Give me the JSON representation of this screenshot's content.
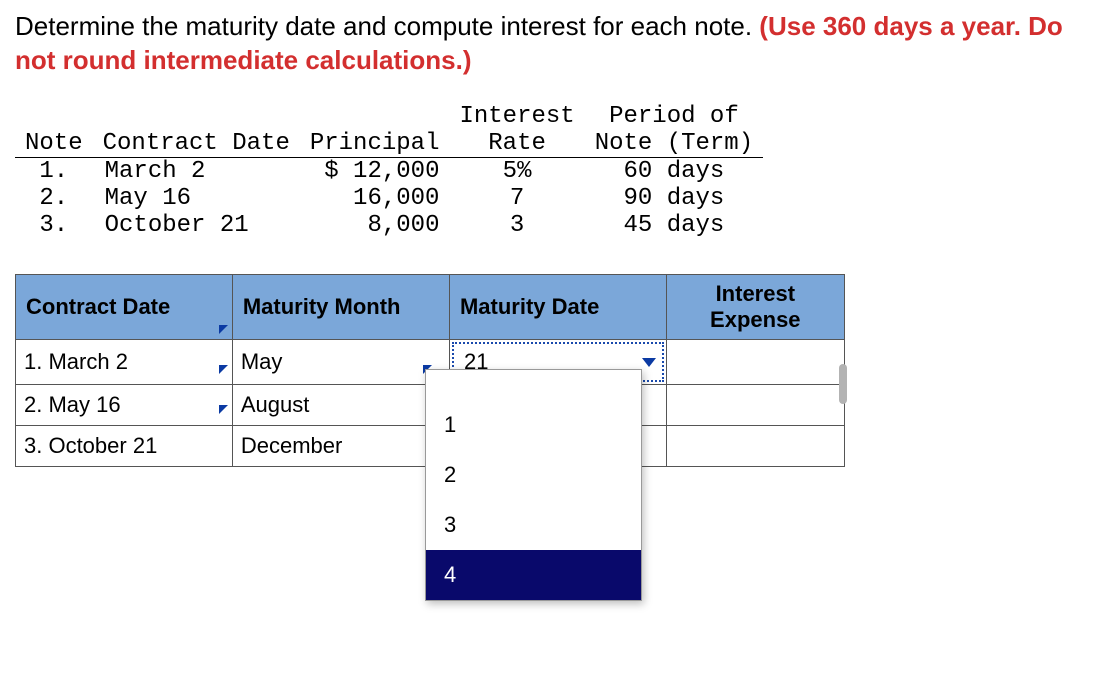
{
  "instruction": {
    "prefix": "Determine the maturity date and compute interest for each note. ",
    "emph": "(Use 360 days a year. Do not round intermediate calculations.)"
  },
  "data_table": {
    "headers": {
      "note": "Note",
      "contract_date": "Contract Date",
      "principal": "Principal",
      "interest_rate_l1": "Interest",
      "interest_rate_l2": "Rate",
      "period_l1": "Period of",
      "period_l2": "Note (Term)"
    },
    "rows": [
      {
        "note": "1.",
        "contract_date": "March 2",
        "principal": "$ 12,000",
        "rate": "5%",
        "term": "60 days"
      },
      {
        "note": "2.",
        "contract_date": "May 16",
        "principal": "16,000",
        "rate": "7",
        "term": "90 days"
      },
      {
        "note": "3.",
        "contract_date": "October 21",
        "principal": "8,000",
        "rate": "3",
        "term": "45 days"
      }
    ]
  },
  "answer_table": {
    "headers": {
      "contract_date": "Contract Date",
      "maturity_month": "Maturity Month",
      "maturity_date": "Maturity Date",
      "interest_expense_l1": "Interest",
      "interest_expense_l2": "Expense"
    },
    "rows": [
      {
        "contract_date": "1. March 2",
        "maturity_month": "May",
        "maturity_date": "21",
        "interest_expense": ""
      },
      {
        "contract_date": "2. May 16",
        "maturity_month": "August",
        "maturity_date": "",
        "interest_expense": ""
      },
      {
        "contract_date": "3. October 21",
        "maturity_month": "December",
        "maturity_date": "",
        "interest_expense": ""
      }
    ]
  },
  "dropdown": {
    "options": [
      "1",
      "2",
      "3",
      "4"
    ],
    "selected": "4"
  }
}
